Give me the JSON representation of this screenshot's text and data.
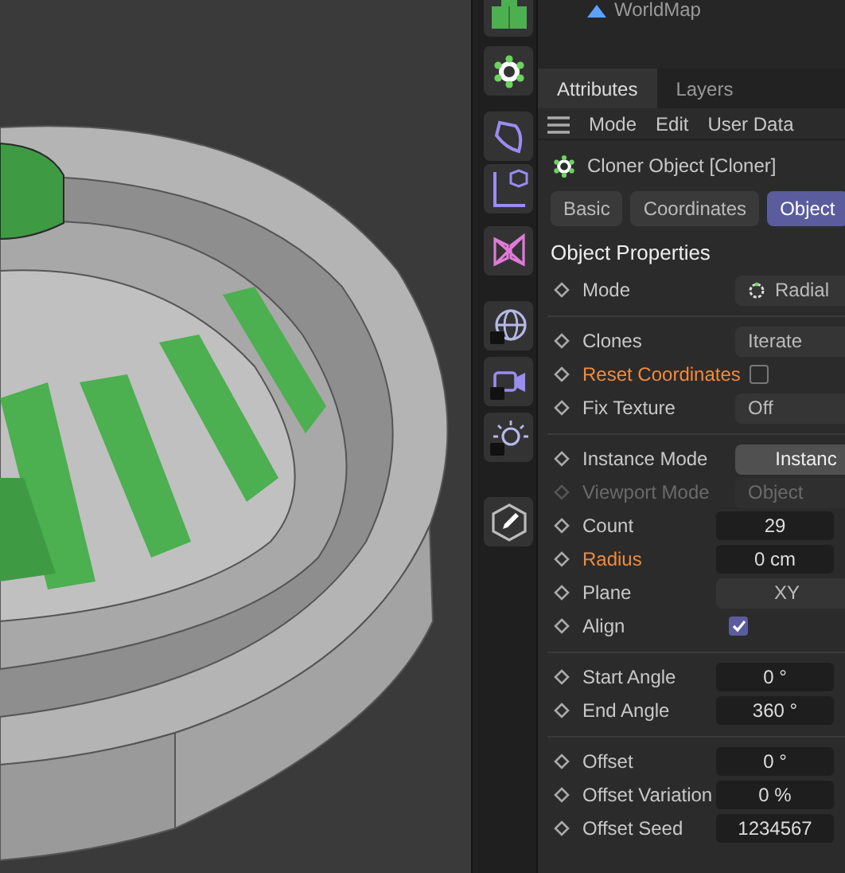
{
  "object_manager": {
    "item": "WorldMap"
  },
  "panel_tabs": [
    {
      "label": "Attributes",
      "selected": true
    },
    {
      "label": "Layers",
      "selected": false
    }
  ],
  "menu": [
    "Mode",
    "Edit",
    "User Data"
  ],
  "object_title": "Cloner Object [Cloner]",
  "section_tabs": [
    {
      "label": "Basic",
      "selected": false
    },
    {
      "label": "Coordinates",
      "selected": false
    },
    {
      "label": "Object",
      "selected": true
    }
  ],
  "section_title": "Object Properties",
  "groups": [
    [
      {
        "kind": "dropdown",
        "label": "Mode",
        "value": "Radial",
        "icon": true,
        "highlight": false,
        "disabled": false
      }
    ],
    [
      {
        "kind": "dropdown",
        "label": "Clones",
        "value": "Iterate",
        "highlight": false,
        "disabled": false
      },
      {
        "kind": "checkbox",
        "label": "Reset Coordinates",
        "checked": false,
        "highlight": true,
        "disabled": false
      },
      {
        "kind": "dropdown",
        "label": "Fix Texture",
        "value": "Off",
        "highlight": false,
        "disabled": false
      }
    ],
    [
      {
        "kind": "button",
        "label": "Instance Mode",
        "value": "Instanc",
        "highlight": false,
        "disabled": false
      },
      {
        "kind": "dropdown",
        "label": "Viewport Mode",
        "value": "Object",
        "highlight": false,
        "disabled": true
      },
      {
        "kind": "number",
        "label": "Count",
        "value": "29",
        "highlight": false,
        "disabled": false
      },
      {
        "kind": "number",
        "label": "Radius",
        "value": "0 cm",
        "highlight": true,
        "disabled": false
      },
      {
        "kind": "select",
        "label": "Plane",
        "value": "XY",
        "highlight": false,
        "disabled": false
      },
      {
        "kind": "checkbox",
        "label": "Align",
        "checked": true,
        "highlight": false,
        "disabled": false
      }
    ],
    [
      {
        "kind": "number",
        "label": "Start Angle",
        "value": "0 °",
        "highlight": false,
        "disabled": false
      },
      {
        "kind": "number",
        "label": "End Angle",
        "value": "360 °",
        "highlight": false,
        "disabled": false
      }
    ],
    [
      {
        "kind": "number",
        "label": "Offset",
        "value": "0 °",
        "highlight": false,
        "disabled": false
      },
      {
        "kind": "number",
        "label": "Offset Variation",
        "value": "0 %",
        "highlight": false,
        "disabled": false
      },
      {
        "kind": "number",
        "label": "Offset Seed",
        "value": "1234567",
        "highlight": false,
        "disabled": false
      }
    ]
  ]
}
